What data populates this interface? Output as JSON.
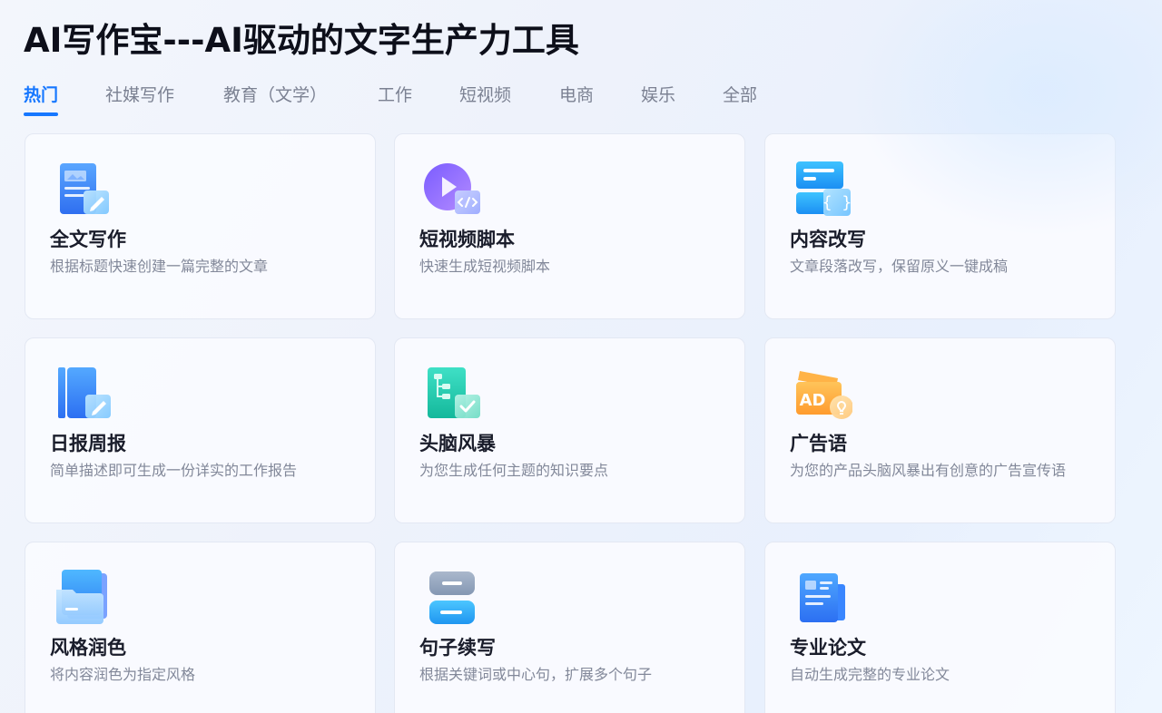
{
  "header": {
    "title": "AI写作宝---AI驱动的文字生产力工具"
  },
  "tabs": [
    {
      "label": "热门",
      "active": true
    },
    {
      "label": "社媒写作"
    },
    {
      "label": "教育（文学）"
    },
    {
      "label": "工作"
    },
    {
      "label": "短视频"
    },
    {
      "label": "电商"
    },
    {
      "label": "娱乐"
    },
    {
      "label": "全部"
    }
  ],
  "cards": [
    {
      "title": "全文写作",
      "desc": "根据标题快速创建一篇完整的文章",
      "icon": "document-edit-icon"
    },
    {
      "title": "短视频脚本",
      "desc": "快速生成短视频脚本",
      "icon": "video-code-icon"
    },
    {
      "title": "内容改写",
      "desc": "文章段落改写，保留原义一键成稿",
      "icon": "code-braces-icon"
    },
    {
      "title": "日报周报",
      "desc": "简单描述即可生成一份详实的工作报告",
      "icon": "book-edit-icon"
    },
    {
      "title": "头脑风暴",
      "desc": "为您生成任何主题的知识要点",
      "icon": "mindmap-check-icon"
    },
    {
      "title": "广告语",
      "desc": "为您的产品头脑风暴出有创意的广告宣传语",
      "icon": "ad-lightbulb-icon"
    },
    {
      "title": "风格润色",
      "desc": "将内容润色为指定风格",
      "icon": "folder-stack-icon"
    },
    {
      "title": "句子续写",
      "desc": "根据关键词或中心句，扩展多个句子",
      "icon": "sentence-blocks-icon"
    },
    {
      "title": "专业论文",
      "desc": "自动生成完整的专业论文",
      "icon": "paper-document-icon"
    }
  ],
  "colors": {
    "accent": "#1677ff",
    "title": "#0d0f1a",
    "tab_inactive": "#7b8192"
  }
}
